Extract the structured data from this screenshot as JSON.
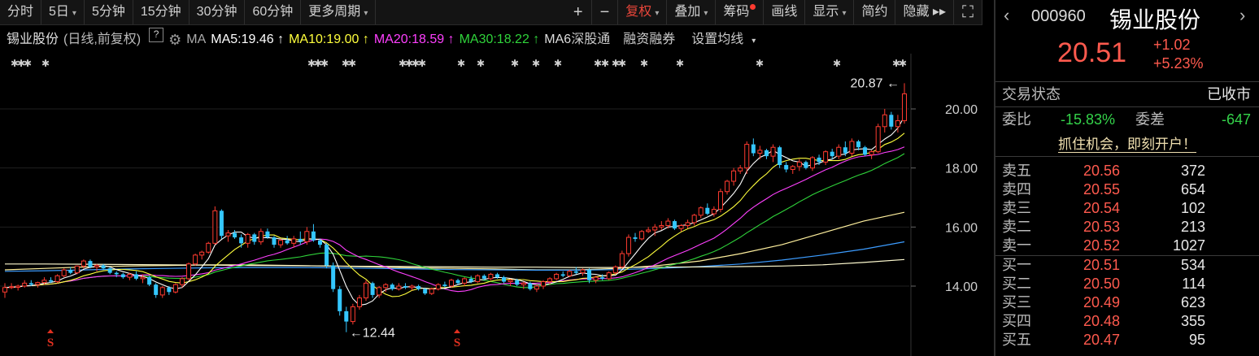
{
  "toolbar": {
    "items": [
      {
        "label": "分时",
        "dropdown": false
      },
      {
        "label": "5日",
        "dropdown": true
      },
      {
        "label": "5分钟",
        "dropdown": false
      },
      {
        "label": "15分钟",
        "dropdown": false
      },
      {
        "label": "30分钟",
        "dropdown": false
      },
      {
        "label": "60分钟",
        "dropdown": false
      },
      {
        "label": "更多周期",
        "dropdown": true
      }
    ],
    "right_items": [
      {
        "label": "+",
        "dropdown": false,
        "selected": false
      },
      {
        "label": "−",
        "dropdown": false,
        "selected": false
      },
      {
        "label": "复权",
        "dropdown": true,
        "selected": true
      },
      {
        "label": "叠加",
        "dropdown": true,
        "selected": false
      },
      {
        "label": "筹码",
        "dropdown": false,
        "selected": false,
        "badge": true
      },
      {
        "label": "画线",
        "dropdown": false,
        "selected": false
      },
      {
        "label": "显示",
        "dropdown": true,
        "selected": false
      },
      {
        "label": "简约",
        "dropdown": false,
        "selected": false
      },
      {
        "label": "隐藏 ▸▸",
        "dropdown": false,
        "selected": false
      },
      {
        "label": "⛶",
        "dropdown": false,
        "selected": false
      }
    ]
  },
  "legend": {
    "stock": "锡业股份",
    "mode": "(日线,前复权)",
    "help": "?",
    "ma_label": "MA",
    "ma5": "MA5:19.46 ↑",
    "ma10": "MA10:19.00 ↑",
    "ma20": "MA20:18.59 ↑",
    "ma30": "MA30:18.22 ↑",
    "ma60": "MA6",
    "link1": "深股通",
    "link2": "融资融券",
    "link3": "设置均线",
    "colors": {
      "ma5": "#ffffff",
      "ma10": "#ffff3c",
      "ma20": "#ff40ff",
      "ma30": "#2fd33a",
      "ma60": "#fff09e",
      "ma120": "#3c9cff",
      "ma250": "#fffbd0"
    }
  },
  "chart_data": {
    "type": "candlestick",
    "ylim": [
      12.0,
      21.0
    ],
    "yticks": [
      14.0,
      16.0,
      18.0,
      20.0
    ],
    "ytick_labels": [
      "14.00",
      "16.00",
      "18.00",
      "20.00"
    ],
    "annot_high": {
      "label": "20.87 ←",
      "value": 20.87
    },
    "annot_low": {
      "label": "←12.44",
      "value": 12.44
    },
    "signals": [
      "S",
      "S"
    ],
    "candles": [
      [
        13.8,
        13.6,
        14.1,
        13.95
      ],
      [
        13.95,
        13.9,
        14.1,
        13.98
      ],
      [
        13.96,
        13.85,
        14.05,
        14.0
      ],
      [
        14.0,
        13.95,
        14.2,
        14.1
      ],
      [
        14.1,
        14.0,
        14.2,
        14.05
      ],
      [
        14.05,
        13.95,
        14.15,
        14.12
      ],
      [
        14.12,
        14.05,
        14.3,
        14.2
      ],
      [
        14.2,
        14.1,
        14.3,
        14.15
      ],
      [
        14.15,
        14.1,
        14.4,
        14.35
      ],
      [
        14.35,
        14.3,
        14.6,
        14.55
      ],
      [
        14.55,
        14.4,
        14.65,
        14.45
      ],
      [
        14.45,
        14.4,
        14.7,
        14.68
      ],
      [
        14.68,
        14.6,
        14.9,
        14.85
      ],
      [
        14.85,
        14.6,
        14.9,
        14.65
      ],
      [
        14.65,
        14.5,
        14.75,
        14.7
      ],
      [
        14.7,
        14.55,
        14.75,
        14.6
      ],
      [
        14.6,
        14.4,
        14.65,
        14.45
      ],
      [
        14.45,
        14.3,
        14.5,
        14.4
      ],
      [
        14.4,
        14.25,
        14.45,
        14.3
      ],
      [
        14.3,
        14.2,
        14.45,
        14.4
      ],
      [
        14.4,
        14.2,
        14.5,
        14.25
      ],
      [
        14.25,
        14.1,
        14.4,
        14.3
      ],
      [
        14.3,
        14.0,
        14.35,
        14.05
      ],
      [
        14.05,
        13.6,
        14.1,
        13.7
      ],
      [
        13.7,
        13.6,
        14.0,
        13.95
      ],
      [
        13.95,
        13.7,
        14.0,
        13.8
      ],
      [
        13.8,
        13.75,
        14.1,
        14.05
      ],
      [
        14.05,
        13.95,
        14.3,
        14.25
      ],
      [
        14.25,
        14.2,
        14.8,
        14.75
      ],
      [
        14.75,
        14.7,
        15.1,
        15.05
      ],
      [
        15.05,
        14.9,
        15.2,
        15.15
      ],
      [
        15.15,
        15.1,
        15.5,
        15.45
      ],
      [
        15.45,
        15.4,
        16.7,
        16.55
      ],
      [
        16.55,
        15.6,
        16.6,
        15.7
      ],
      [
        15.7,
        15.5,
        15.9,
        15.8
      ],
      [
        15.8,
        15.6,
        15.9,
        15.65
      ],
      [
        15.65,
        15.3,
        15.75,
        15.45
      ],
      [
        15.45,
        15.3,
        15.8,
        15.75
      ],
      [
        15.75,
        15.4,
        15.8,
        15.5
      ],
      [
        15.5,
        15.4,
        15.95,
        15.85
      ],
      [
        15.85,
        15.6,
        15.95,
        15.65
      ],
      [
        15.65,
        15.3,
        15.7,
        15.4
      ],
      [
        15.4,
        15.3,
        15.6,
        15.55
      ],
      [
        15.55,
        15.4,
        15.7,
        15.45
      ],
      [
        15.45,
        15.3,
        15.7,
        15.6
      ],
      [
        15.6,
        15.4,
        15.85,
        15.5
      ],
      [
        15.5,
        15.4,
        16.0,
        15.85
      ],
      [
        15.85,
        15.5,
        16.1,
        15.55
      ],
      [
        15.55,
        15.3,
        15.6,
        15.4
      ],
      [
        15.4,
        14.6,
        15.45,
        14.7
      ],
      [
        14.7,
        13.8,
        14.8,
        13.9
      ],
      [
        13.9,
        13.0,
        14.0,
        13.15
      ],
      [
        13.15,
        12.44,
        13.3,
        12.8
      ],
      [
        12.8,
        12.7,
        13.4,
        13.3
      ],
      [
        13.3,
        13.2,
        13.7,
        13.6
      ],
      [
        13.6,
        13.5,
        14.2,
        14.1
      ],
      [
        14.1,
        13.6,
        14.15,
        13.7
      ],
      [
        13.7,
        13.6,
        14.0,
        13.95
      ],
      [
        13.95,
        13.8,
        14.1,
        14.05
      ],
      [
        14.05,
        13.85,
        14.1,
        13.9
      ],
      [
        13.9,
        13.85,
        14.1,
        14.0
      ],
      [
        14.0,
        13.9,
        14.1,
        13.95
      ],
      [
        13.95,
        13.85,
        14.05,
        14.0
      ],
      [
        14.0,
        13.85,
        14.05,
        13.9
      ],
      [
        13.9,
        13.7,
        13.95,
        13.75
      ],
      [
        13.75,
        13.7,
        13.95,
        13.9
      ],
      [
        13.9,
        13.85,
        14.1,
        14.05
      ],
      [
        14.05,
        13.95,
        14.15,
        14.0
      ],
      [
        14.0,
        13.95,
        14.25,
        14.2
      ],
      [
        14.2,
        14.05,
        14.25,
        14.1
      ],
      [
        14.1,
        14.0,
        14.3,
        14.25
      ],
      [
        14.25,
        14.1,
        14.35,
        14.15
      ],
      [
        14.15,
        14.1,
        14.4,
        14.35
      ],
      [
        14.35,
        14.2,
        14.4,
        14.25
      ],
      [
        14.25,
        14.2,
        14.45,
        14.4
      ],
      [
        14.4,
        14.25,
        14.45,
        14.3
      ],
      [
        14.3,
        14.1,
        14.35,
        14.15
      ],
      [
        14.15,
        14.0,
        14.25,
        14.2
      ],
      [
        14.2,
        14.0,
        14.25,
        14.05
      ],
      [
        14.05,
        13.9,
        14.15,
        14.1
      ],
      [
        14.1,
        13.85,
        14.15,
        13.9
      ],
      [
        13.9,
        13.8,
        14.05,
        14.0
      ],
      [
        14.0,
        13.9,
        14.2,
        14.15
      ],
      [
        14.15,
        14.05,
        14.3,
        14.25
      ],
      [
        14.25,
        14.2,
        14.45,
        14.4
      ],
      [
        14.4,
        14.3,
        14.5,
        14.35
      ],
      [
        14.35,
        14.3,
        14.55,
        14.5
      ],
      [
        14.5,
        14.4,
        14.65,
        14.45
      ],
      [
        14.45,
        14.35,
        14.6,
        14.55
      ],
      [
        14.55,
        14.1,
        14.6,
        14.2
      ],
      [
        14.2,
        14.1,
        14.35,
        14.3
      ],
      [
        14.3,
        14.2,
        14.4,
        14.25
      ],
      [
        14.25,
        14.2,
        14.5,
        14.45
      ],
      [
        14.45,
        14.4,
        14.7,
        14.65
      ],
      [
        14.65,
        14.6,
        15.2,
        15.1
      ],
      [
        15.1,
        15.0,
        15.75,
        15.65
      ],
      [
        15.65,
        15.5,
        15.8,
        15.6
      ],
      [
        15.6,
        15.55,
        15.9,
        15.85
      ],
      [
        15.85,
        15.8,
        16.0,
        15.9
      ],
      [
        15.9,
        15.7,
        16.1,
        16.0
      ],
      [
        16.0,
        15.9,
        16.2,
        16.05
      ],
      [
        16.05,
        15.95,
        16.3,
        16.2
      ],
      [
        16.2,
        15.9,
        16.25,
        15.95
      ],
      [
        15.95,
        15.85,
        16.1,
        16.05
      ],
      [
        16.05,
        15.95,
        16.25,
        16.15
      ],
      [
        16.15,
        16.05,
        16.45,
        16.4
      ],
      [
        16.4,
        16.3,
        16.7,
        16.65
      ],
      [
        16.65,
        16.4,
        16.8,
        16.45
      ],
      [
        16.45,
        16.35,
        16.7,
        16.6
      ],
      [
        16.6,
        16.5,
        17.3,
        17.2
      ],
      [
        17.2,
        17.1,
        17.6,
        17.55
      ],
      [
        17.55,
        17.4,
        18.0,
        17.9
      ],
      [
        17.9,
        17.8,
        18.1,
        18.0
      ],
      [
        18.0,
        17.8,
        18.9,
        18.8
      ],
      [
        18.8,
        18.4,
        19.0,
        18.5
      ],
      [
        18.5,
        18.3,
        18.75,
        18.6
      ],
      [
        18.6,
        18.3,
        18.65,
        18.4
      ],
      [
        18.4,
        18.2,
        18.8,
        18.7
      ],
      [
        18.7,
        18.0,
        18.75,
        18.1
      ],
      [
        18.1,
        17.85,
        18.2,
        17.95
      ],
      [
        17.95,
        17.8,
        18.1,
        18.05
      ],
      [
        18.05,
        17.9,
        18.3,
        18.2
      ],
      [
        18.2,
        17.95,
        18.25,
        18.0
      ],
      [
        18.0,
        17.9,
        18.4,
        18.35
      ],
      [
        18.35,
        18.1,
        18.45,
        18.2
      ],
      [
        18.2,
        18.1,
        18.6,
        18.55
      ],
      [
        18.55,
        18.3,
        18.65,
        18.4
      ],
      [
        18.4,
        18.3,
        18.8,
        18.7
      ],
      [
        18.7,
        18.4,
        18.9,
        18.5
      ],
      [
        18.5,
        18.4,
        19.0,
        18.9
      ],
      [
        18.9,
        18.6,
        18.95,
        18.7
      ],
      [
        18.7,
        18.4,
        18.75,
        18.45
      ],
      [
        18.45,
        18.3,
        18.6,
        18.55
      ],
      [
        18.55,
        18.5,
        19.5,
        19.4
      ],
      [
        19.4,
        19.2,
        20.0,
        19.8
      ],
      [
        19.8,
        19.3,
        19.9,
        19.4
      ],
      [
        19.4,
        19.2,
        19.8,
        19.6
      ],
      [
        19.6,
        19.5,
        20.87,
        20.51
      ]
    ],
    "flat_lines": [
      {
        "name": "ma60",
        "color": "#fff09e",
        "values": [
          14.55,
          14.6,
          14.65,
          14.68,
          14.7,
          14.72,
          14.72,
          14.7,
          14.68,
          14.65,
          14.62,
          14.6,
          14.58,
          14.55,
          14.55,
          14.6,
          14.7,
          14.85,
          15.1,
          15.4,
          15.8,
          16.2,
          16.5
        ]
      },
      {
        "name": "ma120",
        "color": "#3c9cff",
        "values": [
          14.5,
          14.52,
          14.55,
          14.58,
          14.6,
          14.62,
          14.63,
          14.63,
          14.62,
          14.6,
          14.58,
          14.56,
          14.55,
          14.54,
          14.54,
          14.56,
          14.6,
          14.66,
          14.75,
          14.88,
          15.05,
          15.25,
          15.5
        ]
      },
      {
        "name": "ma250",
        "color": "#fffbd0",
        "values": [
          14.75,
          14.75,
          14.74,
          14.73,
          14.72,
          14.71,
          14.7,
          14.69,
          14.68,
          14.67,
          14.66,
          14.65,
          14.64,
          14.64,
          14.63,
          14.63,
          14.64,
          14.65,
          14.66,
          14.68,
          14.72,
          14.8,
          14.9
        ]
      }
    ]
  },
  "quote": {
    "code": "000960",
    "name": "锡业股份",
    "price": "20.51",
    "change": "+1.02",
    "change_pct": "+5.23%",
    "status_label": "交易状态",
    "status_value": "已收市",
    "wb_label": "委比",
    "wb_value": "-15.83%",
    "wc_label": "委差",
    "wc_value": "-647",
    "promo": "抓住机会，即刻开户！",
    "asks": [
      {
        "label": "卖五",
        "price": "20.56",
        "vol": "372"
      },
      {
        "label": "卖四",
        "price": "20.55",
        "vol": "654"
      },
      {
        "label": "卖三",
        "price": "20.54",
        "vol": "102"
      },
      {
        "label": "卖二",
        "price": "20.53",
        "vol": "213"
      },
      {
        "label": "卖一",
        "price": "20.52",
        "vol": "1027"
      }
    ],
    "bids": [
      {
        "label": "买一",
        "price": "20.51",
        "vol": "534"
      },
      {
        "label": "买二",
        "price": "20.50",
        "vol": "114"
      },
      {
        "label": "买三",
        "price": "20.49",
        "vol": "623"
      },
      {
        "label": "买四",
        "price": "20.48",
        "vol": "355"
      },
      {
        "label": "买五",
        "price": "20.47",
        "vol": "95"
      }
    ]
  }
}
